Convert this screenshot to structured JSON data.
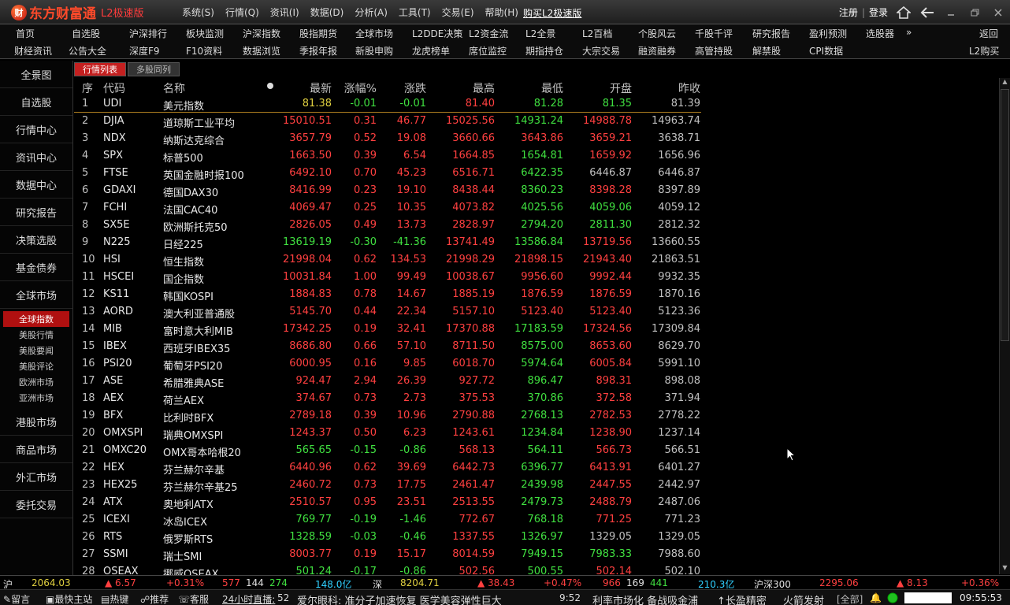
{
  "titlebar": {
    "logo_text": "东方财富通",
    "logo_sub": "L2极速版",
    "menu": [
      "系统(S)",
      "行情(Q)",
      "资讯(I)",
      "数据(D)",
      "分析(A)",
      "工具(T)",
      "交易(E)",
      "帮助(H)"
    ],
    "buy_link": "购买L2极速版",
    "register": "注册",
    "login": "登录"
  },
  "nav": {
    "row1": [
      "首页",
      "自选股",
      "沪深排行",
      "板块监测",
      "沪深指数",
      "股指期货",
      "全球市场",
      "L2DDE决策",
      "L2资金流",
      "L2全景",
      "L2百档",
      "个股风云",
      "千股千评",
      "研究报告",
      "盈利预测",
      "选股器",
      "»",
      "返回"
    ],
    "row2": [
      "财经资讯",
      "公告大全",
      "深度F9",
      "F10资料",
      "数据浏览",
      "季报年报",
      "新股申购",
      "龙虎榜单",
      "席位监控",
      "期指持仓",
      "大宗交易",
      "融资融券",
      "高管持股",
      "解禁股",
      "CPI数据",
      "L2购买"
    ]
  },
  "sidebar": {
    "main_top": [
      "全景图",
      "自选股",
      "行情中心",
      "资讯中心",
      "数据中心",
      "研究报告",
      "决策选股",
      "基金债券",
      "全球市场"
    ],
    "subs": [
      "全球指数",
      "美股行情",
      "美股要闻",
      "美股评论",
      "欧洲市场",
      "亚洲市场"
    ],
    "main_bottom": [
      "港股市场",
      "商品市场",
      "外汇市场",
      "委托交易"
    ]
  },
  "tabs": [
    "行情列表",
    "多股同列"
  ],
  "table": {
    "headers": [
      "序",
      "代码",
      "名称",
      "最新",
      "涨幅%",
      "涨跌",
      "最高",
      "最低",
      "开盘",
      "昨收"
    ],
    "rows": [
      [
        "1",
        "UDI",
        "美元指数",
        "81.38",
        "-0.01",
        "-0.01",
        "81.40",
        "81.28",
        "81.35",
        "81.39"
      ],
      [
        "2",
        "DJIA",
        "道琼斯工业平均",
        "15010.51",
        "0.31",
        "46.77",
        "15025.56",
        "14931.24",
        "14988.78",
        "14963.74"
      ],
      [
        "3",
        "NDX",
        "纳斯达克综合",
        "3657.79",
        "0.52",
        "19.08",
        "3660.66",
        "3643.86",
        "3659.21",
        "3638.71"
      ],
      [
        "4",
        "SPX",
        "标普500",
        "1663.50",
        "0.39",
        "6.54",
        "1664.85",
        "1654.81",
        "1659.92",
        "1656.96"
      ],
      [
        "5",
        "FTSE",
        "英国金融时报100",
        "6492.10",
        "0.70",
        "45.23",
        "6516.71",
        "6422.35",
        "6446.87",
        "6446.87"
      ],
      [
        "6",
        "GDAXI",
        "德国DAX30",
        "8416.99",
        "0.23",
        "19.10",
        "8438.44",
        "8360.23",
        "8398.28",
        "8397.89"
      ],
      [
        "7",
        "FCHI",
        "法国CAC40",
        "4069.47",
        "0.25",
        "10.35",
        "4073.82",
        "4025.56",
        "4059.06",
        "4059.12"
      ],
      [
        "8",
        "SX5E",
        "欧洲斯托克50",
        "2826.05",
        "0.49",
        "13.73",
        "2828.97",
        "2794.20",
        "2811.30",
        "2812.32"
      ],
      [
        "9",
        "N225",
        "日经225",
        "13619.19",
        "-0.30",
        "-41.36",
        "13741.49",
        "13586.84",
        "13719.56",
        "13660.55"
      ],
      [
        "10",
        "HSI",
        "恒生指数",
        "21998.04",
        "0.62",
        "134.53",
        "21998.29",
        "21898.15",
        "21943.40",
        "21863.51"
      ],
      [
        "11",
        "HSCEI",
        "国企指数",
        "10031.84",
        "1.00",
        "99.49",
        "10038.67",
        "9956.60",
        "9992.44",
        "9932.35"
      ],
      [
        "12",
        "KS11",
        "韩国KOSPI",
        "1884.83",
        "0.78",
        "14.67",
        "1885.19",
        "1876.59",
        "1876.59",
        "1870.16"
      ],
      [
        "13",
        "AORD",
        "澳大利亚普通股",
        "5145.70",
        "0.44",
        "22.34",
        "5157.10",
        "5123.40",
        "5123.40",
        "5123.36"
      ],
      [
        "14",
        "MIB",
        "富时意大利MIB",
        "17342.25",
        "0.19",
        "32.41",
        "17370.88",
        "17183.59",
        "17324.56",
        "17309.84"
      ],
      [
        "15",
        "IBEX",
        "西班牙IBEX35",
        "8686.80",
        "0.66",
        "57.10",
        "8711.50",
        "8575.00",
        "8653.60",
        "8629.70"
      ],
      [
        "16",
        "PSI20",
        "葡萄牙PSI20",
        "6000.95",
        "0.16",
        "9.85",
        "6018.70",
        "5974.64",
        "6005.84",
        "5991.10"
      ],
      [
        "17",
        "ASE",
        "希腊雅典ASE",
        "924.47",
        "2.94",
        "26.39",
        "927.72",
        "896.47",
        "898.31",
        "898.08"
      ],
      [
        "18",
        "AEX",
        "荷兰AEX",
        "374.67",
        "0.73",
        "2.73",
        "375.53",
        "370.86",
        "372.58",
        "371.94"
      ],
      [
        "19",
        "BFX",
        "比利时BFX",
        "2789.18",
        "0.39",
        "10.96",
        "2790.88",
        "2768.13",
        "2782.53",
        "2778.22"
      ],
      [
        "20",
        "OMXSPI",
        "瑞典OMXSPI",
        "1243.37",
        "0.50",
        "6.23",
        "1243.61",
        "1234.84",
        "1238.90",
        "1237.14"
      ],
      [
        "21",
        "OMXC20",
        "OMX哥本哈根20",
        "565.65",
        "-0.15",
        "-0.86",
        "568.13",
        "564.11",
        "566.73",
        "566.51"
      ],
      [
        "22",
        "HEX",
        "芬兰赫尔辛基",
        "6440.96",
        "0.62",
        "39.69",
        "6442.73",
        "6396.77",
        "6413.91",
        "6401.27"
      ],
      [
        "23",
        "HEX25",
        "芬兰赫尔辛基25",
        "2460.72",
        "0.73",
        "17.75",
        "2461.47",
        "2439.98",
        "2447.55",
        "2442.97"
      ],
      [
        "24",
        "ATX",
        "奥地利ATX",
        "2510.57",
        "0.95",
        "23.51",
        "2513.55",
        "2479.73",
        "2488.79",
        "2487.06"
      ],
      [
        "25",
        "ICEXI",
        "冰岛ICEX",
        "769.77",
        "-0.19",
        "-1.46",
        "772.67",
        "768.18",
        "771.25",
        "771.23"
      ],
      [
        "26",
        "RTS",
        "俄罗斯RTS",
        "1328.59",
        "-0.03",
        "-0.46",
        "1337.55",
        "1326.97",
        "1329.05",
        "1329.05"
      ],
      [
        "27",
        "SSMI",
        "瑞士SMI",
        "8003.77",
        "0.19",
        "15.17",
        "8014.59",
        "7949.15",
        "7983.33",
        "7988.60"
      ],
      [
        "28",
        "OSEAX",
        "挪威OSEAX",
        "501.24",
        "-0.17",
        "-0.86",
        "502.56",
        "500.55",
        "502.14",
        "502.10"
      ]
    ]
  },
  "status1": {
    "sh_label": "沪",
    "sh_index": "2064.03",
    "sh_change": "▲ 6.57",
    "sh_pct": "+0.31%",
    "sh_up": "577",
    "sh_flat": "144",
    "sh_down": "274",
    "sh_amount": "148.0亿",
    "sz_label": "深",
    "sz_index": "8204.71",
    "sz_change": "▲ 38.43",
    "sz_pct": "+0.47%",
    "sz_up": "966",
    "sz_flat": "169",
    "sz_down": "441",
    "sz_amount": "210.3亿",
    "hs300_label": "沪深300",
    "hs300_index": "2295.06",
    "hs300_change": "▲ 8.13",
    "hs300_pct": "+0.36%"
  },
  "status2": {
    "items": [
      "留言",
      "最快主站",
      "热键",
      "推荐",
      "客服"
    ],
    "live_label": "24小时直播:",
    "live_count": "52",
    "ticker": "爱尔眼科: 准分子加速恢复 医学美容弹性巨大",
    "time1": "9:52",
    "news": "利率市场化 备战吸金浦",
    "promo1": "↑长盈精密",
    "promo2": "火箭发射",
    "filter": "[全部]",
    "clock": "09:55:53"
  }
}
